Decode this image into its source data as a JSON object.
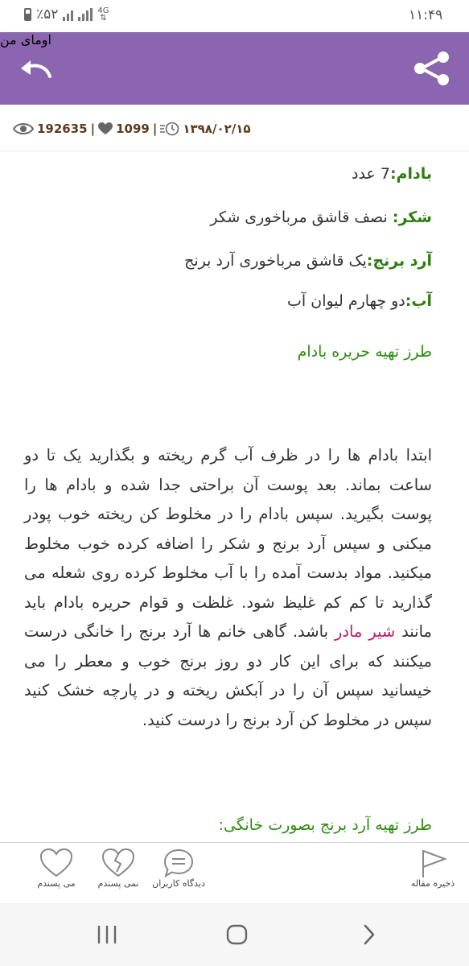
{
  "status": {
    "time": "۱۱:۴۹",
    "battery": "٪۵۲",
    "network": "4G"
  },
  "appbar": {
    "title": "اومای من"
  },
  "meta": {
    "views": "192635",
    "likes": "1099",
    "date": "۱۳۹۸/۰۲/۱۵"
  },
  "ingredients": [
    {
      "name": "بادام:",
      "value": "7 عدد"
    },
    {
      "name": "شکر:",
      "value": " نصف قاشق مرباخوری شکر"
    },
    {
      "name": "آرد برنج:",
      "value": "یک قاشق مرباخوری آرد برنج"
    },
    {
      "name": "آب:",
      "value": "دو چهارم لیوان آب"
    }
  ],
  "heading1": "طرز تهیه حریره بادام",
  "paragraph": {
    "part1": "ابتدا بادام ها را در ظرف آب گرم ریخته و بگذارید یک تا دو ساعت بماند. بعد پوست آن براحتی جدا شده و بادام ها را پوست بگیرید. سپس بادام را در مخلوط کن ریخته خوب پودر میکنی و سپس آرد برنج و شکر را اضافه کرده خوب مخلوط میکنید. مواد بدست آمده را با آب مخلوط کرده روی شعله می گذارید تا کم کم غلیظ شود. غلظت و قوام حریره بادام باید مانند ",
    "link": "شیر مادر",
    "part2": " باشد. گاهی خانم ها آرد برنج را خانگی درست میکنند که برای این کار دو روز برنج خوب و معطر را می خیسانید سپس آن را در آبکش ریخته و در پارچه خشک کنید سپس در مخلوط کن آرد برنج را درست کنید."
  },
  "heading2": "طرز تهیه آرد برنج بصورت خانگی:",
  "bottom": {
    "like": "می پسندم",
    "dislike": "نمی پسندم",
    "comments": "دیدگاه کاربران",
    "save": "ذخیره مقاله"
  },
  "colors": {
    "accent": "#8b65b0",
    "green": "#2e7d0f",
    "link": "#c2186b"
  }
}
